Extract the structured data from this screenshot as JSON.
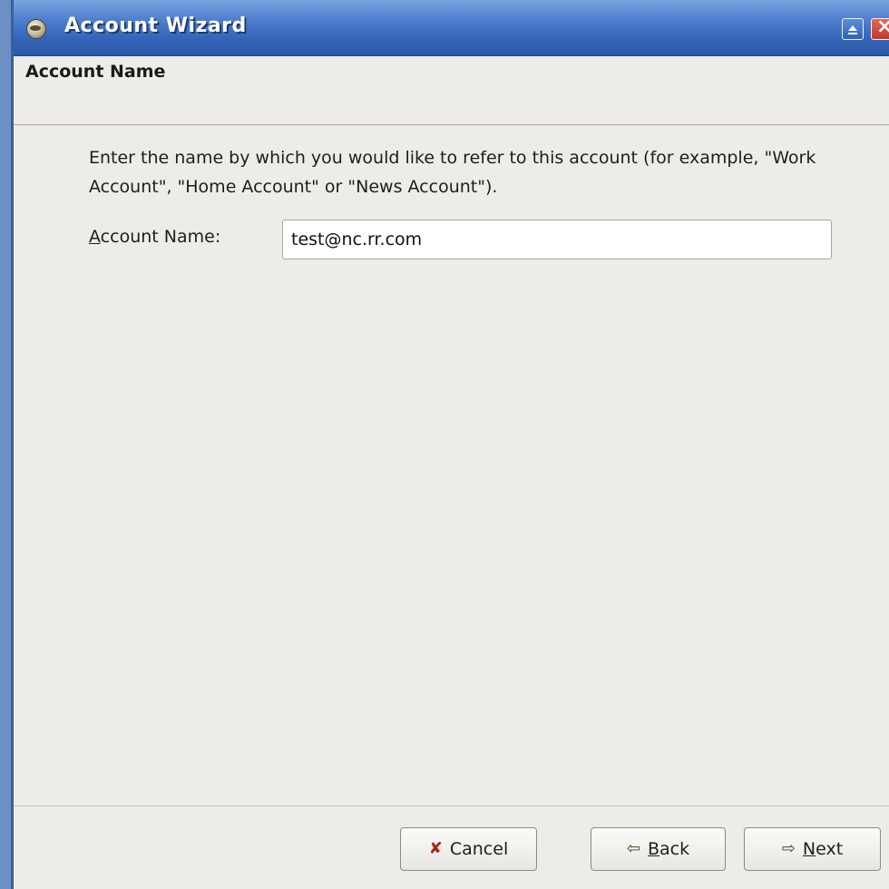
{
  "window": {
    "title": "Account Wizard"
  },
  "header": {
    "title": "Account Name"
  },
  "content": {
    "intro_text": "Enter the name by which you would like to refer to this account (for example, \"Work Account\", \"Home Account\" or \"News Account\").",
    "field_label_mnemonic": "A",
    "field_label_rest": "ccount Name:",
    "field_value": "test@nc.rr.com"
  },
  "buttons": {
    "cancel_label": "Cancel",
    "back_mnemonic": "B",
    "back_rest": "ack",
    "next_mnemonic": "N",
    "next_rest": "ext"
  },
  "icons": {
    "app": "thunderbird-icon",
    "cancel": "x-mark-icon",
    "back": "arrow-left-icon",
    "next": "arrow-right-icon"
  }
}
